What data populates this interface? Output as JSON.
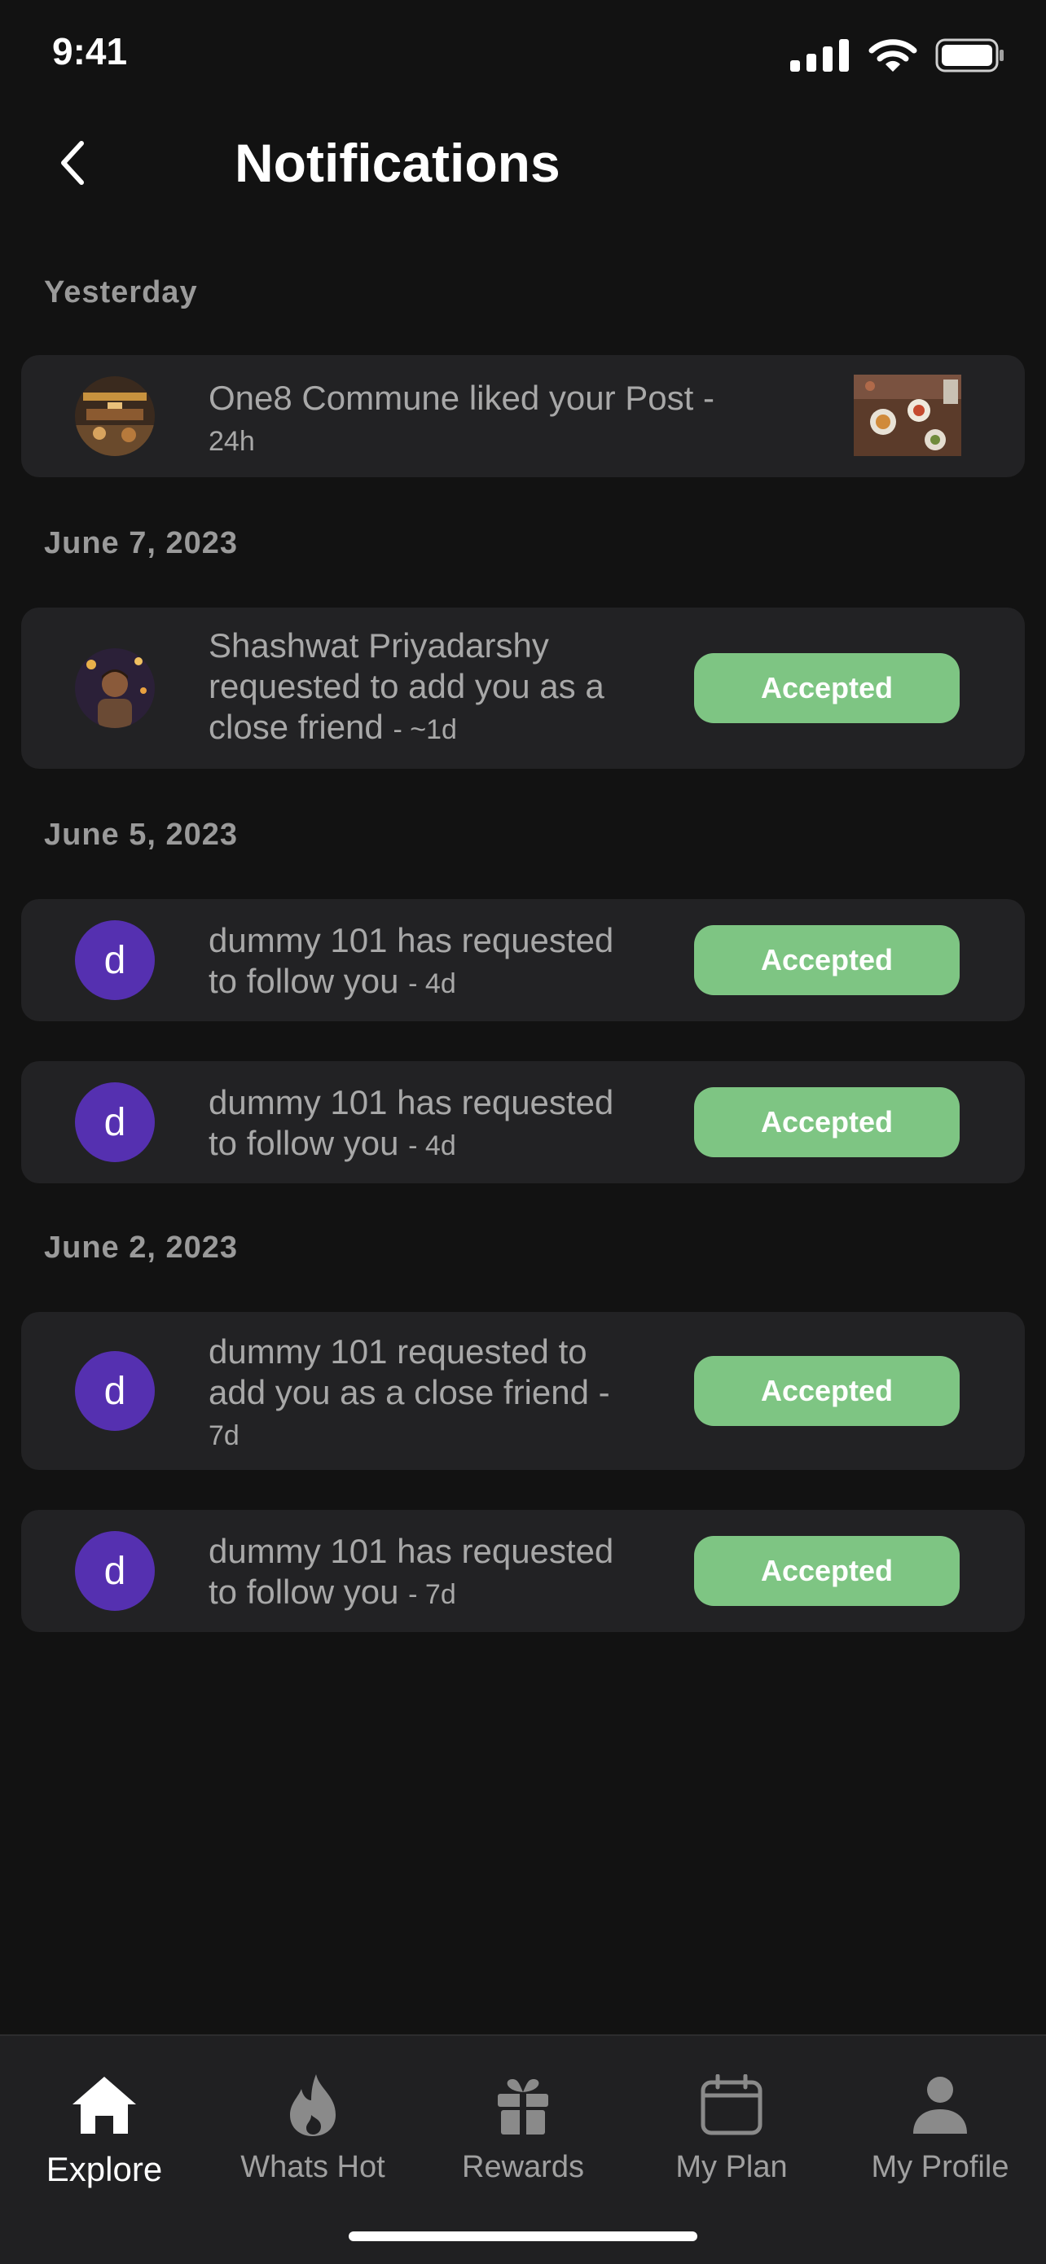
{
  "status_bar": {
    "time": "9:41"
  },
  "header": {
    "title": "Notifications"
  },
  "sections": [
    {
      "label": "Yesterday"
    },
    {
      "label": "June 7, 2023"
    },
    {
      "label": "June 5, 2023"
    },
    {
      "label": "June 2, 2023"
    }
  ],
  "notifications": [
    {
      "line1": "One8 Commune  liked your Post",
      "line2": "",
      "time": "24h"
    },
    {
      "line1": "Shashwat Priyadarshy",
      "line2": "requested to add you as a",
      "line3": "close friend",
      "time": "~1d",
      "button": "Accepted"
    },
    {
      "avatar_letter": "d",
      "line1": "dummy 101 has requested",
      "line2": "to follow you",
      "time": "4d",
      "button": "Accepted"
    },
    {
      "avatar_letter": "d",
      "line1": "dummy 101 has requested",
      "line2": "to follow you",
      "time": "4d",
      "button": "Accepted"
    },
    {
      "avatar_letter": "d",
      "line1": "dummy 101 requested to",
      "line2": "add you as a close friend",
      "time": "7d",
      "button": "Accepted"
    },
    {
      "avatar_letter": "d",
      "line1": "dummy 101 has requested",
      "line2": "to follow you",
      "time": "7d",
      "button": "Accepted"
    }
  ],
  "tab_bar": {
    "tabs": [
      {
        "label": "Explore",
        "icon": "home-icon",
        "active": true
      },
      {
        "label": "Whats Hot",
        "icon": "flame-icon"
      },
      {
        "label": "Rewards",
        "icon": "gift-icon"
      },
      {
        "label": "My Plan",
        "icon": "calendar-icon"
      },
      {
        "label": "My Profile",
        "icon": "person-icon"
      }
    ]
  },
  "colors": {
    "accent_button": "#7ec583",
    "avatar_purple": "#5530b0",
    "background": "#121212",
    "card": "#222224"
  }
}
